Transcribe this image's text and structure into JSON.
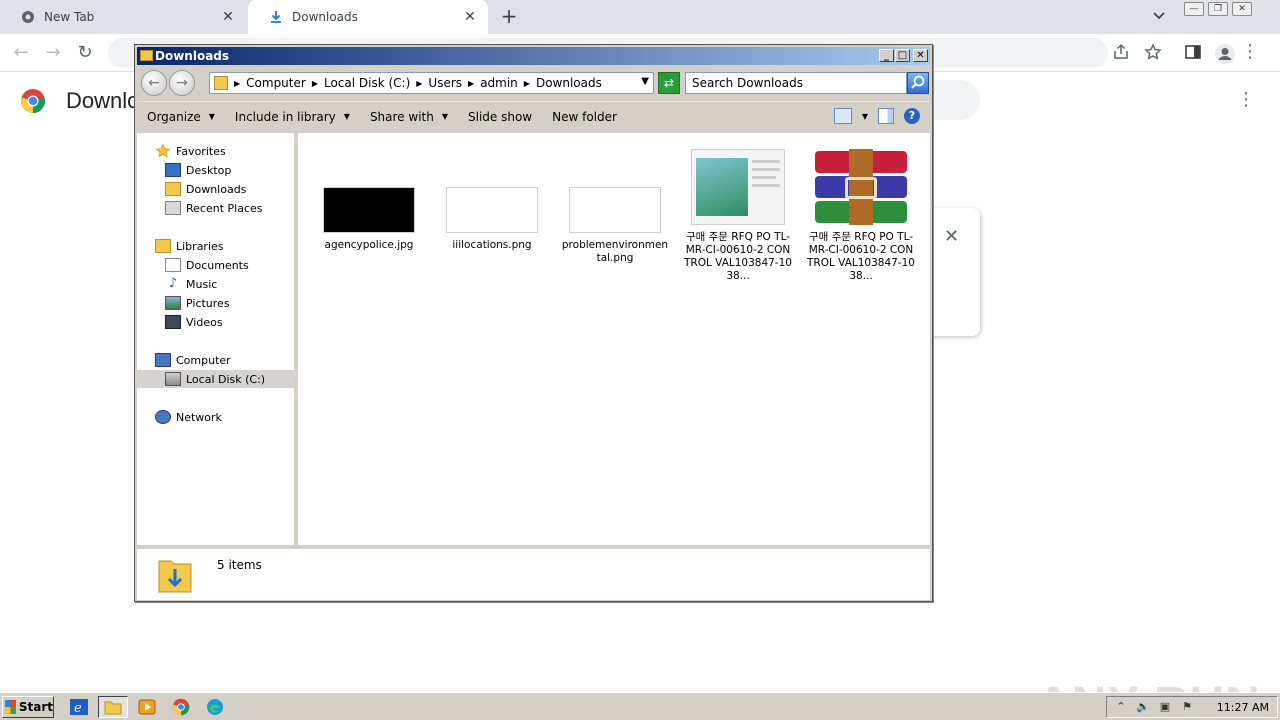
{
  "chrome": {
    "tabs": [
      {
        "label": "New Tab"
      },
      {
        "label": "Downloads"
      }
    ],
    "page_title": "Downloads"
  },
  "explorer": {
    "title": "Downloads",
    "breadcrumb": [
      "Computer",
      "Local Disk (C:)",
      "Users",
      "admin",
      "Downloads"
    ],
    "search_placeholder": "Search Downloads",
    "commands": [
      {
        "label": "Organize",
        "has_caret": true
      },
      {
        "label": "Include in library",
        "has_caret": true
      },
      {
        "label": "Share with",
        "has_caret": true
      },
      {
        "label": "Slide show",
        "has_caret": false
      },
      {
        "label": "New folder",
        "has_caret": false
      }
    ],
    "nav": {
      "favorites": "Favorites",
      "desktop": "Desktop",
      "downloads": "Downloads",
      "recent": "Recent Places",
      "libraries": "Libraries",
      "documents": "Documents",
      "music": "Music",
      "pictures": "Pictures",
      "videos": "Videos",
      "computer": "Computer",
      "local_disk": "Local Disk (C:)",
      "network": "Network"
    },
    "files": [
      {
        "name": "agencypolice.jpg",
        "kind": "black-image"
      },
      {
        "name": "iiilocations.png",
        "kind": "white-image"
      },
      {
        "name": "problemenvironmen tal.png",
        "kind": "white-image"
      },
      {
        "name": "구매 주문 RFQ PO TL-MR-CI-00610-2 CONTROL VAL103847-1038...",
        "kind": "document-preview"
      },
      {
        "name": "구매 주문 RFQ PO TL-MR-CI-00610-2 CONTROL VAL103847-1038...",
        "kind": "winrar-archive"
      }
    ],
    "status": "5 items"
  },
  "taskbar": {
    "start_label": "Start",
    "clock": "11:27 AM"
  },
  "watermark": "ANY RUN"
}
